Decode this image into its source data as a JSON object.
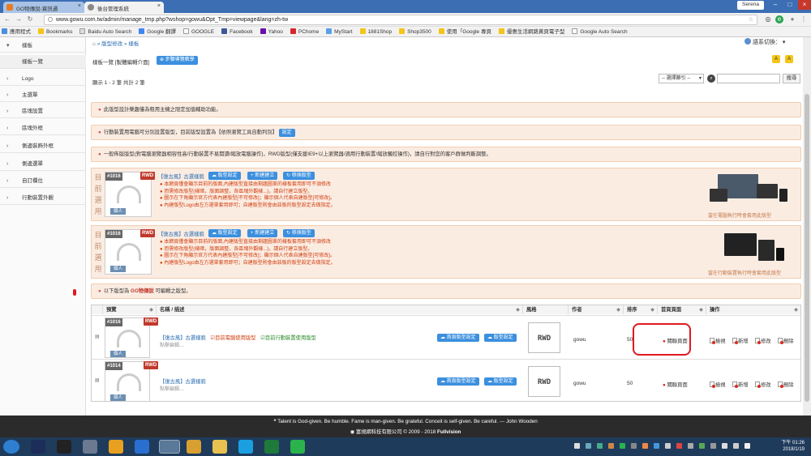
{
  "browser": {
    "tabs": [
      {
        "title": "GO物傳說-資訊通"
      },
      {
        "title": "後台管理系統"
      }
    ],
    "user": "Serena",
    "url": "www.gowu.com.tw/admin/manage_tmp.php?wshop=gowu&Opt_Tmp=viewpage&lang=zh-tw",
    "bookmarks": [
      "應用程式",
      "Bookmarks",
      "Baidu Auto Search",
      "Google 翻譯",
      "GOOGLE",
      "Facebook",
      "Yahoo",
      "PChome",
      "MyStart",
      "1881Shop",
      "Shop3500",
      "使用「Google 專頁",
      "優惠生活網路黃頁電子型",
      "Google Auto Search"
    ]
  },
  "sidebar": {
    "items": [
      {
        "label": "樣板",
        "expanded": true
      },
      {
        "label": "樣板一覽",
        "sub": true
      },
      {
        "label": "Logo"
      },
      {
        "label": "主選單"
      },
      {
        "label": "區塊設置"
      },
      {
        "label": "區塊外框"
      },
      {
        "label": "側邊裝飾外框"
      },
      {
        "label": "側邊選單"
      },
      {
        "label": "自訂欄位"
      },
      {
        "label": "行動裝置外觀"
      }
    ]
  },
  "header": {
    "breadcrumb": "» 版型修改 » 樣板",
    "lang_switch": "語系切換：",
    "page_title": "樣板一覽 [製體編輯介面]",
    "tutorial_btn": "步驟導覽教學",
    "count_text": "顯示 1 - 2 筆 共計 2 筆",
    "filter_select": "-- 選擇篩引 --",
    "search_btn": "搜尋"
  },
  "notices": {
    "n1": "此版型設計樂趣僅為租用主機之限定加值輔助功能。",
    "n2_text": "行動裝置用電腦可分別設置版型，目前版型設置為【依照瀏覽工具自動判別】",
    "n2_btn": "設定",
    "n3": "一般佈版版型(對電腦瀏覽器相容性高/行動裝置不易閱讀/縮放電腦操作)，RWD版型(僅支援IE9+以上瀏覽器/適用行動裝置/縮放觸控操作)，請自行對您的客戶群做判斷調整。",
    "n4_prefix": "以下版型為",
    "n4_brand": "GO物傳說",
    "n4_suffix": "可編輯之版型。"
  },
  "current_label": "目前選用",
  "panels": [
    {
      "num": "#1016",
      "rwd": "RWD",
      "tag": "個人",
      "name": "【復古風】古選樣貌",
      "btn_set": "版型設定",
      "btn_new": "新建建立",
      "btn_switch": "移換版型",
      "lines": [
        "本網頁僅會顯示目前的版面,內建版型直接由剩趨圖單的樣板套用即可不須修改",
        "而需修改版型(樣暗，版面調整，各區塊外觀樣...)，請自行建立版型。",
        "圖示在下角顯示官方代表內建版型[不可修改]；顯示個人代表自建版型[可修改]。",
        "內建版型Logo由左方選單套用即可；自建版型則會由該板的版型設定去做指定。"
      ],
      "caption": "當在電腦執行時會套用此版型"
    },
    {
      "num": "#1016",
      "rwd": "RWD",
      "tag": "個人",
      "name": "【復古風】古選樣貌",
      "btn_set": "版型設定",
      "btn_new": "新建建立",
      "btn_switch": "移換版型",
      "lines": [
        "本網頁僅會顯示目前的版面,內建版型直接由剩趨圖單的樣板套用即可不須修改",
        "而需修改版型(樣暗，版面調整，各區塊外觀樣...)，請自行建立版型。",
        "圖示在下角顯示官方代表內建版型[不可修改]；顯示個人代表自建版型[可修改]。",
        "內建版型Logo由左方選單套用即可；自建版型則會由該板的版型設定去做指定。"
      ],
      "caption": "當在行動裝置執行時會套用此版型"
    }
  ],
  "table": {
    "headers": [
      "預覽",
      "名稱 / 描述",
      "風格",
      "作者",
      "排序",
      "首頁頁面",
      "操作"
    ],
    "rows": [
      {
        "num": "#1016",
        "rwd": "RWD",
        "tag": "個人",
        "name": "【復古風】古選樣貌",
        "check1": "目前電腦使用版型",
        "check2": "目前行動裝置使用版型",
        "desc": "點擊編輯....",
        "btn_home": "首頁版型設定",
        "btn_set": "版型設定",
        "style": "RWD",
        "author": "gowu",
        "order": "50",
        "home": "關聯頁面"
      },
      {
        "num": "#1014",
        "rwd": "RWD",
        "tag": "個人",
        "name": "【復古風】古選樣貌",
        "desc": "點擊編輯....",
        "btn_home": "首頁版型設定",
        "btn_set": "版型設定",
        "style": "RWD",
        "author": "gowu",
        "order": "50",
        "home": "關聯頁面"
      }
    ],
    "actions": [
      "檢視",
      "新增",
      "修改",
      "刪除"
    ]
  },
  "footer": {
    "quote": "Talent is God-given. Be humble. Fame is man-given. Be grateful. Conceit is self-given. Be careful. --- John Wooden",
    "copyright_prefix": "富視網科技有限公司 © 2009 - 2018",
    "copyright_brand": "Fullvision"
  },
  "taskbar": {
    "time": "下午 01:26",
    "date": "2018/1/19"
  },
  "colors": {
    "accent_blue": "#3b8fde",
    "notice_bg": "#fbece2",
    "rwd_red": "#c0392b",
    "highlight_ring": "#e0191f"
  }
}
